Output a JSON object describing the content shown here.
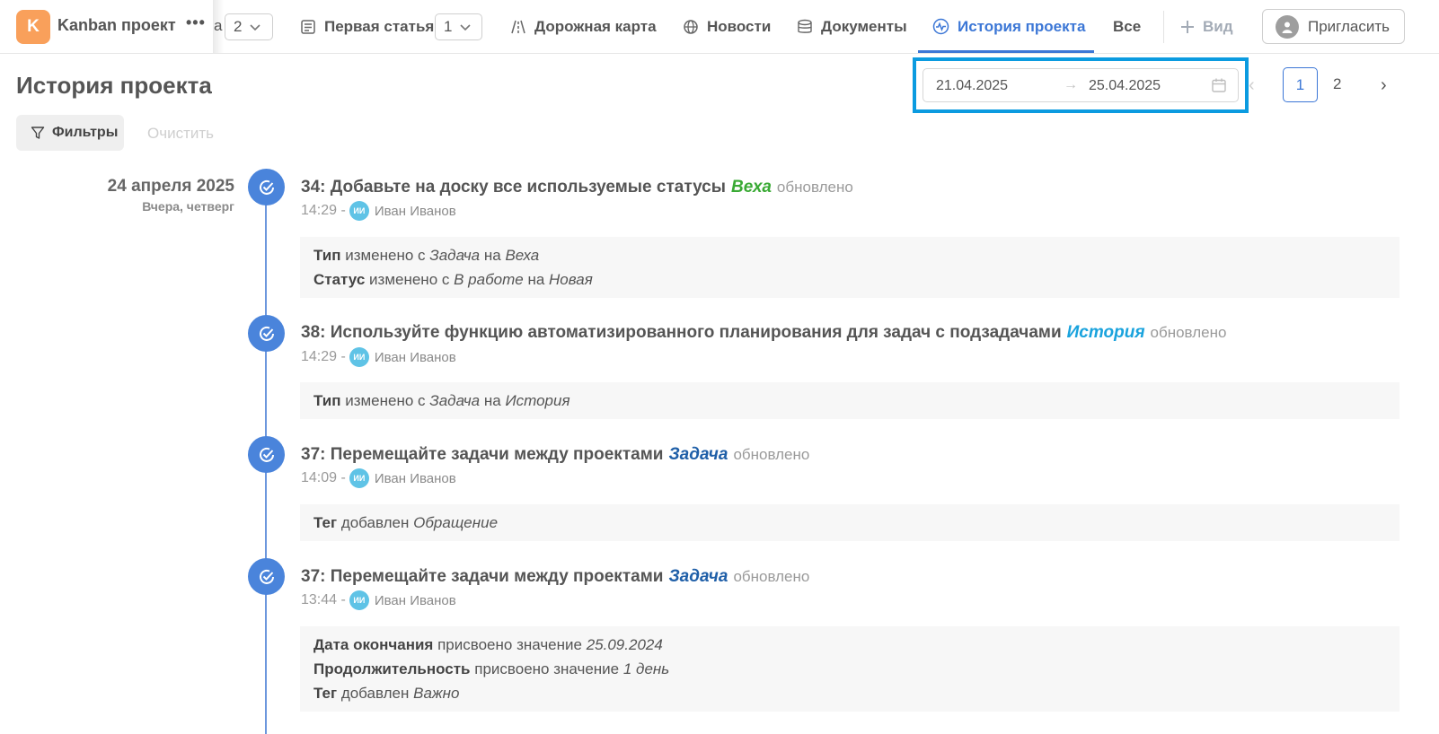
{
  "topbar": {
    "project_badge": "K",
    "project_name": "Kanban проект",
    "more": "•••",
    "crumb_letter": "а",
    "select1_value": "2",
    "tab_first_article": "Первая статья",
    "select2_value": "1",
    "tab_roadmap": "Дорожная карта",
    "tab_news": "Новости",
    "tab_docs": "Документы",
    "tab_history": "История проекта",
    "tab_all": "Все",
    "tab_add_view": "Вид",
    "invite_label": "Пригласить"
  },
  "header": {
    "title": "История проекта",
    "date_from": "21.04.2025",
    "date_arrow": "→",
    "date_to": "25.04.2025",
    "pagination": {
      "prev": "‹",
      "current": "1",
      "page2": "2",
      "next": "›"
    }
  },
  "filters": {
    "filter_label": "Фильтры",
    "clear_label": "Очистить"
  },
  "day": {
    "date": "24 апреля 2025",
    "subtitle": "Вчера, четверг"
  },
  "colors": {
    "accent": "#3c77d6",
    "type_veha": "#3aaa35",
    "type_history": "#1aa3dd",
    "type_task": "#1f5fa8",
    "highlight": "#0b9be0",
    "project_badge": "#f9a05b"
  },
  "events": [
    {
      "title": "34: Добавьте на доску все используемые статусы",
      "type": "Веха",
      "action": "обновлено",
      "time": "14:29 -",
      "user_initials": "ИИ",
      "user": "Иван Иванов",
      "changes": [
        {
          "field": "Тип",
          "verb": "изменено с",
          "from": "Задача",
          "conj": "на",
          "to": "Веха"
        },
        {
          "field": "Статус",
          "verb": "изменено с",
          "from": "В работе",
          "conj": "на",
          "to": "Новая"
        }
      ]
    },
    {
      "title": "38: Используйте функцию автоматизированного планирования для задач с подзадачами",
      "type": "История",
      "action": "обновлено",
      "time": "14:29 -",
      "user_initials": "ИИ",
      "user": "Иван Иванов",
      "changes": [
        {
          "field": "Тип",
          "verb": "изменено с",
          "from": "Задача",
          "conj": "на",
          "to": "История"
        }
      ]
    },
    {
      "title": "37: Перемещайте задачи между проектами",
      "type": "Задача",
      "action": "обновлено",
      "time": "14:09 -",
      "user_initials": "ИИ",
      "user": "Иван Иванов",
      "changes": [
        {
          "field": "Тег",
          "verb": "добавлен",
          "from": "Обращение",
          "conj": "",
          "to": ""
        }
      ]
    },
    {
      "title": "37: Перемещайте задачи между проектами",
      "type": "Задача",
      "action": "обновлено",
      "time": "13:44 -",
      "user_initials": "ИИ",
      "user": "Иван Иванов",
      "changes": [
        {
          "field": "Дата окончания",
          "verb": "присвоено значение",
          "from": "25.09.2024",
          "conj": "",
          "to": ""
        },
        {
          "field": "Продолжительность",
          "verb": "присвоено значение",
          "from": "1 день",
          "conj": "",
          "to": ""
        },
        {
          "field": "Тег",
          "verb": "добавлен",
          "from": "Важно",
          "conj": "",
          "to": ""
        }
      ]
    }
  ]
}
